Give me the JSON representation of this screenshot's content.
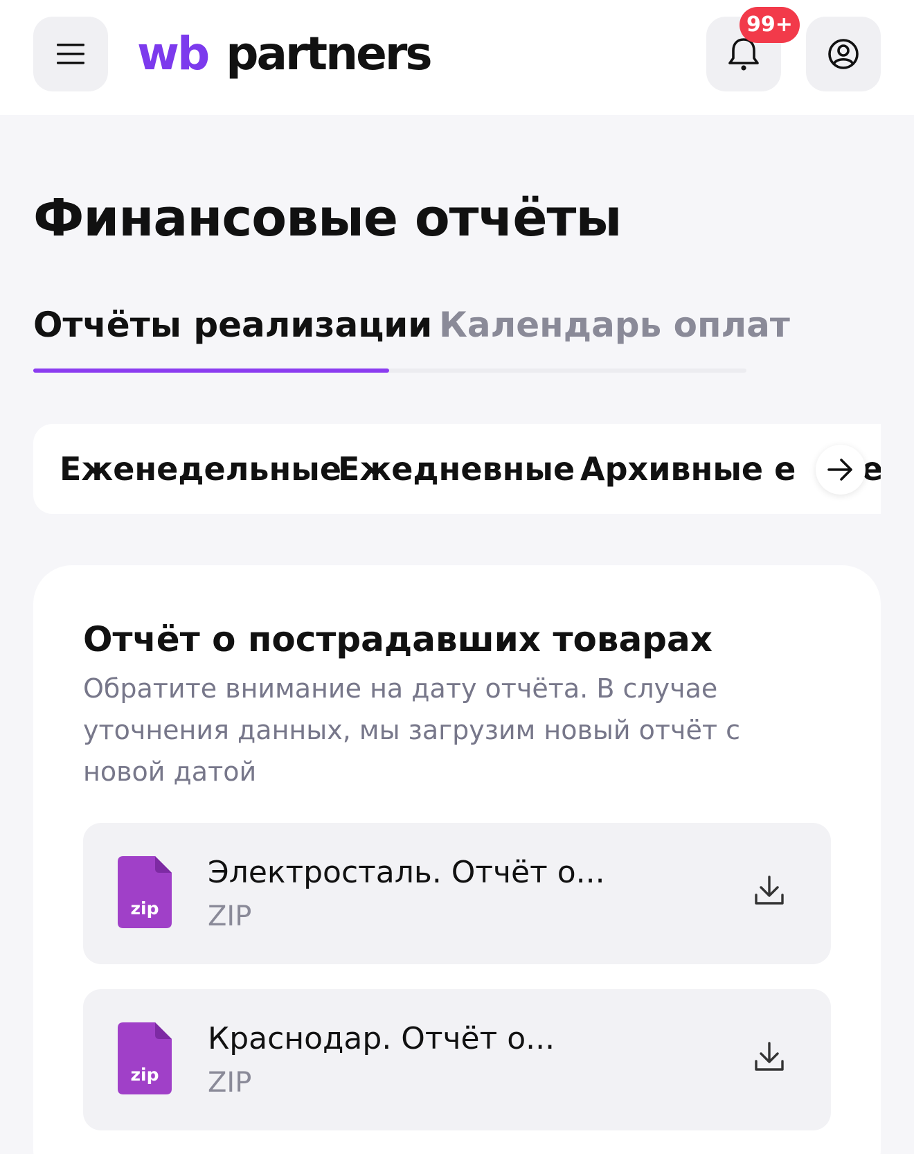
{
  "header": {
    "logo_wb": "wb",
    "logo_partners": "partners",
    "notifications_badge": "99+",
    "icons": {
      "menu": "hamburger-menu-icon",
      "bell": "bell-icon",
      "profile": "user-circle-icon"
    }
  },
  "page": {
    "title": "Финансовые отчёты"
  },
  "tabs": [
    {
      "label": "Отчёты реализации",
      "active": true
    },
    {
      "label": "Календарь оплат",
      "active": false
    }
  ],
  "chips": [
    {
      "label": "Еженедельные"
    },
    {
      "label": "Ежедневные"
    },
    {
      "label": "Архивные ежене"
    },
    {
      "label": "е"
    }
  ],
  "card": {
    "title": "Отчёт о пострадавших товарах",
    "description": "Обратите внимание на дату отчёта. В случае уточнения данных, мы загрузим новый отчёт с новой датой",
    "files": [
      {
        "name": "Электросталь. Отчёт о...",
        "type": "ZIP",
        "icon_label": "zip"
      },
      {
        "name": "Краснодар. Отчёт о...",
        "type": "ZIP",
        "icon_label": "zip"
      }
    ]
  },
  "colors": {
    "accent": "#8b3cf0",
    "logo_purple": "#7c3aed",
    "badge_red": "#f23a4a",
    "file_icon": "#a040c8",
    "background": "#f6f6f9"
  }
}
